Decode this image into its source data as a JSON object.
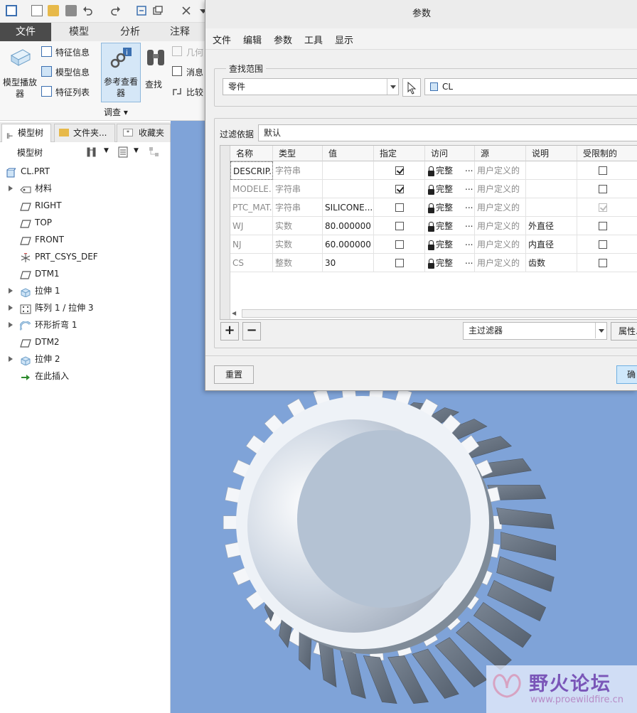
{
  "ribbon_tabs": [
    "文件",
    "模型",
    "分析",
    "注释"
  ],
  "ribbon": {
    "model_player": "模型播放器",
    "feature_info": "特征信息",
    "model_info": "模型信息",
    "feature_list": "特征列表",
    "reference_viewer": "参考查看器",
    "find": "查找",
    "geometry": "几何",
    "message": "消息",
    "compare": "比较",
    "group_label": "调查"
  },
  "panel_tabs": [
    "模型树",
    "文件夹...",
    "收藏夹"
  ],
  "tree": {
    "header": "模型树",
    "items": [
      {
        "label": "CL.PRT",
        "icon": "part-icon",
        "level": 0,
        "expandable": false
      },
      {
        "label": "材料",
        "icon": "material-icon",
        "level": 1,
        "expandable": true
      },
      {
        "label": "RIGHT",
        "icon": "datum-plane-icon",
        "level": 1,
        "expandable": false
      },
      {
        "label": "TOP",
        "icon": "datum-plane-icon",
        "level": 1,
        "expandable": false
      },
      {
        "label": "FRONT",
        "icon": "datum-plane-icon",
        "level": 1,
        "expandable": false
      },
      {
        "label": "PRT_CSYS_DEF",
        "icon": "csys-icon",
        "level": 1,
        "expandable": false
      },
      {
        "label": "DTM1",
        "icon": "datum-plane-icon",
        "level": 1,
        "expandable": false
      },
      {
        "label": "拉伸 1",
        "icon": "extrude-icon",
        "level": 1,
        "expandable": true
      },
      {
        "label": "阵列 1 / 拉伸 3",
        "icon": "pattern-icon",
        "level": 1,
        "expandable": true
      },
      {
        "label": "环形折弯 1",
        "icon": "toroidal-bend-icon",
        "level": 1,
        "expandable": true
      },
      {
        "label": "DTM2",
        "icon": "datum-plane-icon",
        "level": 1,
        "expandable": false
      },
      {
        "label": "拉伸 2",
        "icon": "extrude-icon",
        "level": 1,
        "expandable": true
      },
      {
        "label": "在此插入",
        "icon": "insert-arrow-icon",
        "level": 1,
        "expandable": false
      }
    ]
  },
  "dialog": {
    "title": "参数",
    "menu": [
      "文件",
      "编辑",
      "参数",
      "工具",
      "显示"
    ],
    "scope_label": "查找范围",
    "scope_value": "零件",
    "scope_object": "CL",
    "filter_label": "过滤依据",
    "filter_value": "默认",
    "columns": [
      "名称",
      "类型",
      "值",
      "指定",
      "访问",
      "源",
      "说明",
      "受限制的"
    ],
    "rows": [
      {
        "name": "DESCRIP...",
        "type": "字符串",
        "value": "",
        "designated": true,
        "access": "完整",
        "source": "用户定义的",
        "description": "",
        "restricted": false,
        "restricted_disabled": false,
        "value_gray": false
      },
      {
        "name": "MODELE...",
        "type": "字符串",
        "value": "",
        "designated": true,
        "access": "完整",
        "source": "用户定义的",
        "description": "",
        "restricted": false,
        "restricted_disabled": false,
        "value_gray": false
      },
      {
        "name": "PTC_MAT...",
        "type": "字符串",
        "value": "SILICONE...",
        "designated": false,
        "access": "完整",
        "source": "用户定义的",
        "description": "",
        "restricted": true,
        "restricted_disabled": true,
        "value_gray": false
      },
      {
        "name": "WJ",
        "type": "实数",
        "value": "80.000000",
        "designated": false,
        "access": "完整",
        "source": "用户定义的",
        "description": "外直径",
        "restricted": false,
        "restricted_disabled": false,
        "value_gray": false
      },
      {
        "name": "NJ",
        "type": "实数",
        "value": "60.000000",
        "designated": false,
        "access": "完整",
        "source": "用户定义的",
        "description": "内直径",
        "restricted": false,
        "restricted_disabled": false,
        "value_gray": false
      },
      {
        "name": "CS",
        "type": "整数",
        "value": "30",
        "designated": false,
        "access": "完整",
        "source": "用户定义的",
        "description": "齿数",
        "restricted": false,
        "restricted_disabled": false,
        "value_gray": false
      }
    ],
    "add_symbol": "+",
    "remove_symbol": "−",
    "main_filter": "主过滤器",
    "properties_btn": "属性...",
    "reset_btn": "重置",
    "ok_btn": "确"
  },
  "watermark": {
    "title": "野火论坛",
    "url": "www.proewildfire.cn"
  },
  "colors": {
    "viewport_bg": "#7fa3d8",
    "active_tab": "#4b4b4b",
    "ok_button": "#cfe8fb"
  }
}
